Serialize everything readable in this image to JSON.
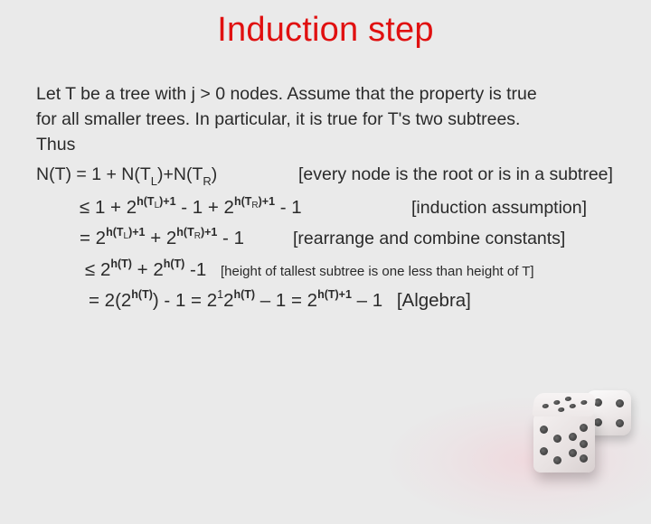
{
  "slide": {
    "title": "Induction step",
    "title_color": "#e01010",
    "background_color": "#eaeaea",
    "text_color": "#2a2a2a",
    "paragraph": {
      "line1": "Let T be a tree with j > 0 nodes.  Assume that the property is true",
      "line2": "for all smaller trees.  In particular, it is true for T's two subtrees.",
      "line3": "Thus"
    },
    "derivation": [
      {
        "expr": {
          "a": "N(T) = 1 + N(T",
          "sub_l": "L",
          "b": ")+N(T",
          "sub_r": "R",
          "c": ")"
        },
        "justification": "[every node is the root or is in a subtree]"
      },
      {
        "expr": {
          "a": "≤ 1 + 2",
          "exp1": "h(T",
          "exp1_sub": "L",
          "exp1_tail": ")+1",
          "b": " - 1  + 2",
          "exp2": "h(T",
          "exp2_sub": "R",
          "exp2_tail": ")+1",
          "c": " - 1"
        },
        "justification": "[induction assumption]"
      },
      {
        "expr": {
          "a": "= 2",
          "exp1": "h(T",
          "exp1_sub": "L",
          "exp1_tail": ")+1",
          "b": " + 2",
          "exp2": "h(T",
          "exp2_sub": "R",
          "exp2_tail": ")+1",
          "c": " - 1"
        },
        "justification": "[rearrange and combine constants]"
      },
      {
        "expr": {
          "a": "≤ 2",
          "exp1": "h(T)",
          "b": " + 2",
          "exp2": "h(T)",
          "c": " -1"
        },
        "justification": "[height of tallest subtree is one less than height of T]"
      },
      {
        "expr": {
          "a": "= 2(2",
          "exp1": "h(T)",
          "b": ") - 1   = 2",
          "exp_one": "1",
          "c": "2",
          "exp2": "h(T)",
          "d": " – 1 = 2",
          "exp3": "h(T)+1",
          "e": " – 1"
        },
        "justification": "[Algebra]"
      }
    ],
    "decoration": {
      "icon": "dice-icon",
      "dice": [
        "six-face",
        "four-face"
      ]
    }
  }
}
